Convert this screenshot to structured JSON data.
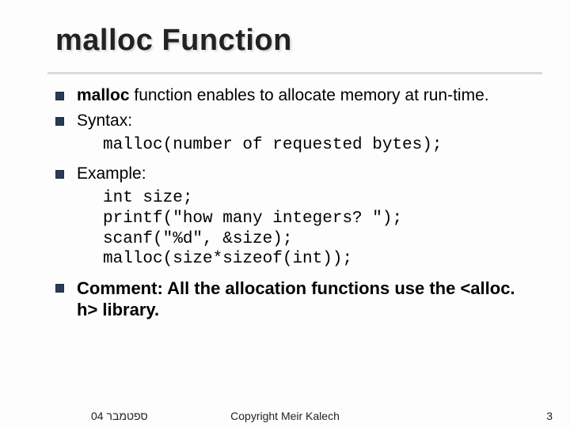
{
  "title": "malloc Function",
  "items": [
    {
      "bold_prefix": "malloc",
      "rest": " function enables to allocate memory at run-time."
    },
    {
      "text": "Syntax:"
    }
  ],
  "syntax_code": "malloc(number of requested bytes);",
  "example_label": "Example:",
  "example_code": "int size;\nprintf(\"how many integers? \");\nscanf(\"%d\", &size);\nmalloc(size*sizeof(int));",
  "comment": {
    "label": "Comment:",
    "text": " All the allocation functions use the <alloc. h> library."
  },
  "footer": {
    "date": "ספטמבר 04",
    "copyright": "Copyright Meir Kalech",
    "page": "3"
  }
}
